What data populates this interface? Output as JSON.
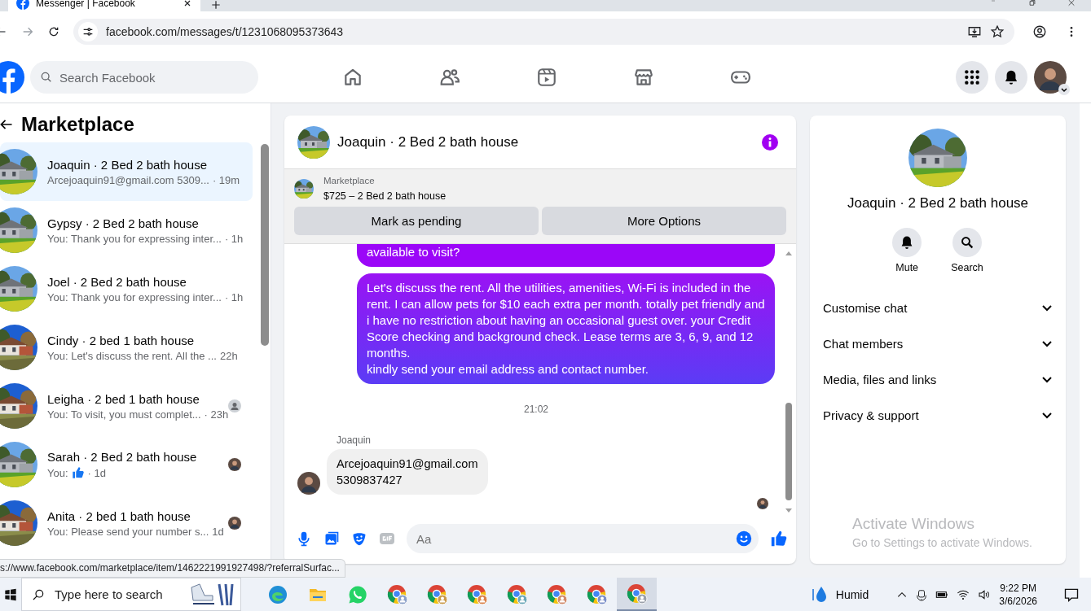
{
  "browser": {
    "tab_title": "Messenger | Facebook",
    "url": "facebook.com/messages/t/1231068095373643",
    "status_url": "s://www.facebook.com/marketplace/item/1462221991927498/?referralSurfac..."
  },
  "header": {
    "search_placeholder": "Search Facebook"
  },
  "sidebar": {
    "title": "Marketplace",
    "conversations": [
      {
        "name": "Joaquin · 2 Bed 2 bath house",
        "preview": "Arcejoaquin91@gmail.com 5309...",
        "time": "· 19m",
        "selected": true
      },
      {
        "name": "Gypsy · 2 Bed 2 bath house",
        "preview": "You: Thank you for expressing inter...",
        "time": "· 1h",
        "selected": false
      },
      {
        "name": "Joel · 2 Bed 2 bath house",
        "preview": "You: Thank you for expressing inter...",
        "time": "· 1h",
        "selected": false
      },
      {
        "name": "Cindy · 2 bed 1 bath house",
        "preview": "You: Let's discuss the rent. All the ...",
        "time": "22h",
        "selected": false
      },
      {
        "name": "Leigha · 2 bed 1 bath house",
        "preview": "You: To visit, you must complet...",
        "time": "· 23h",
        "selected": false,
        "read_receipt": {
          "kind": "generic"
        }
      },
      {
        "name": "Sarah · 2 Bed 2 bath house",
        "preview": "You:",
        "kind": "like",
        "time": "· 1d",
        "selected": false
      },
      {
        "name": "Anita · 2 bed 1 bath house",
        "preview": "You: Please send your number s...",
        "time": "1d",
        "selected": false
      }
    ]
  },
  "chat": {
    "title": "Joaquin · 2 Bed 2 bath house",
    "listing": {
      "label": "Marketplace",
      "title": "$725 – 2 Bed 2 bath house"
    },
    "buttons": [
      "Mark as pending",
      "More Options"
    ],
    "messages": [
      {
        "kind": "outgoing",
        "text": "available to visit?",
        "cut": true
      },
      {
        "kind": "outgoing",
        "text": "Let's discuss the rent. All the utilities, amenities, Wi-Fi is included in the rent. I can allow pets for $10 each extra per month. totally pet friendly and i have no restriction about having an occasional guest over. your Credit Score checking and background check. Lease terms are 3, 6, 9, and 12 months.\nkindly send your email address and contact number."
      },
      {
        "kind": "timestamp",
        "text": "21:02"
      },
      {
        "kind": "incoming",
        "sender": "Joaquin",
        "text": "Arcejoaquin91@gmail.com\n5309837427"
      }
    ],
    "composer_placeholder": "Aa"
  },
  "details": {
    "name": "Joaquin · 2 Bed 2 bath house",
    "actions": [
      {
        "kind": "mute",
        "label": "Mute"
      },
      {
        "kind": "search",
        "label": "Search"
      }
    ],
    "sections": [
      "Customise chat",
      "Chat members",
      "Media, files and links",
      "Privacy & support"
    ]
  },
  "activation": {
    "title": "Activate Windows",
    "subtitle": "Go to Settings to activate Windows."
  },
  "taskbar": {
    "search_placeholder": "Type here to search",
    "weather": "Humid",
    "time": "9:22 PM",
    "date": "3/6/2026"
  }
}
